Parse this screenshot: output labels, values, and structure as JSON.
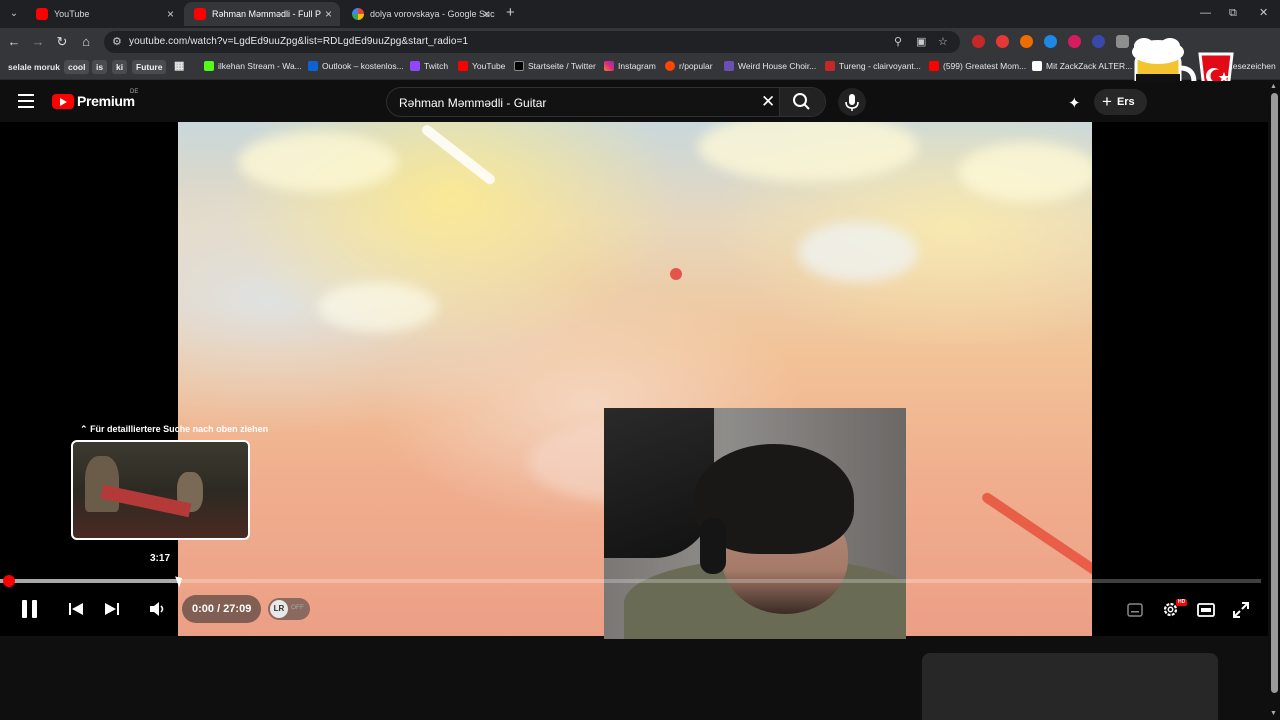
{
  "browser": {
    "tabs": [
      {
        "title": "YouTube",
        "active": false
      },
      {
        "title": "Rəhman Məmmədli - Full P",
        "active": true
      },
      {
        "title": "dolya vorovskaya - Google Suc",
        "active": false
      }
    ],
    "new_tab": "+",
    "url": "youtube.com/watch?v=LgdEd9uuZpg&list=RDLgdEd9uuZpg&start_radio=1",
    "bookmarks": [
      {
        "label": "selale moruk"
      },
      {
        "label": "cool"
      },
      {
        "label": "is"
      },
      {
        "label": "ki"
      },
      {
        "label": "Future"
      },
      {
        "label": "ilkehan Stream - Wa..."
      },
      {
        "label": "Outlook – kostenlos..."
      },
      {
        "label": "Twitch"
      },
      {
        "label": "YouTube"
      },
      {
        "label": "Startseite / Twitter"
      },
      {
        "label": "Instagram"
      },
      {
        "label": "r/popular"
      },
      {
        "label": "Weird House Choir..."
      },
      {
        "label": "Tureng - clairvoyant..."
      },
      {
        "label": "(599) Greatest Mom..."
      },
      {
        "label": "Mit ZackZack ALTER..."
      },
      {
        "label": "Lesezeichen"
      }
    ],
    "colors": {
      "tab_bar": "#1f2023",
      "toolbar": "#35363a",
      "accent": "#ff0000"
    }
  },
  "youtube": {
    "logo": "Premium",
    "country_code": "DE",
    "search_query": "Rəhman Məmmədli - Guitar",
    "create_label": "Ers",
    "icons": {
      "menu": "hamburger-icon",
      "search": "search-icon",
      "clear": "close-icon",
      "voice": "mic-icon",
      "create_extra": "sparkle-icon"
    }
  },
  "player": {
    "preview_hint": "Für detailliertere Suche nach oben ziehen",
    "preview_time": "3:17",
    "current_time": "0:00",
    "duration": "27:09",
    "time_display": "0:00 / 27:09",
    "progress_fraction": 0.0,
    "hover_fraction": 0.1427,
    "ambient_label": "OFF",
    "ambient_logo": "LR",
    "quality_badge": "HD",
    "controls": [
      "pause-icon",
      "previous-icon",
      "next-icon",
      "volume-icon",
      "subtitles-icon",
      "settings-icon",
      "theater-mode-icon",
      "fullscreen-icon"
    ]
  }
}
